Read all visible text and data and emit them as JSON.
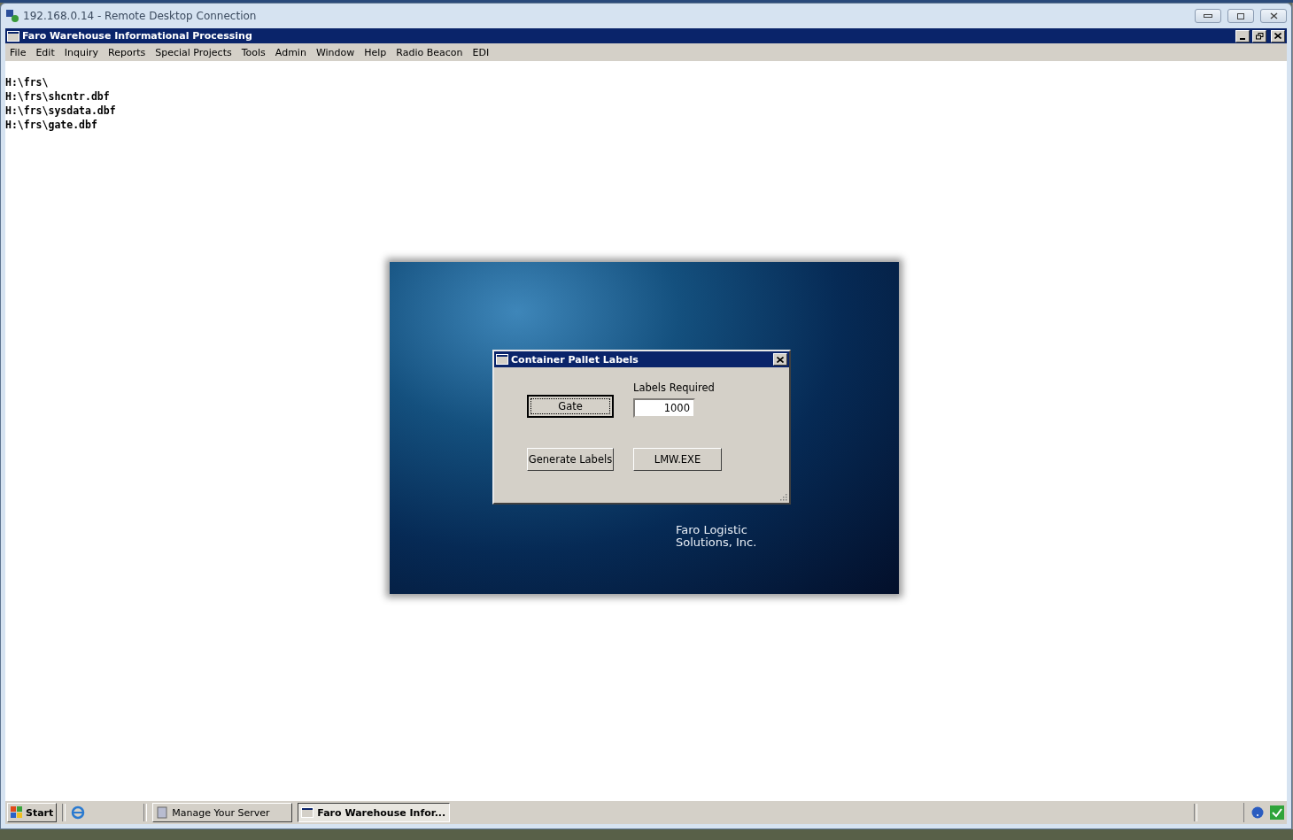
{
  "rdp_window": {
    "title": "192.168.0.14 - Remote Desktop Connection"
  },
  "app_window": {
    "title": "Faro Warehouse Informational Processing"
  },
  "menu": [
    {
      "label": "File"
    },
    {
      "label": "Edit"
    },
    {
      "label": "Inquiry"
    },
    {
      "label": "Reports"
    },
    {
      "label": "Special Projects"
    },
    {
      "label": "Tools"
    },
    {
      "label": "Admin"
    },
    {
      "label": "Window"
    },
    {
      "label": "Help"
    },
    {
      "label": "Radio Beacon"
    },
    {
      "label": "EDI"
    }
  ],
  "output_lines": [
    "H:\\frs\\",
    "H:\\frs\\shcntr.dbf",
    "H:\\frs\\sysdata.dbf",
    "H:\\frs\\gate.dbf"
  ],
  "splash": {
    "caption_lines": [
      "Faro Logistic",
      "Solutions, Inc."
    ]
  },
  "dialog": {
    "title": "Container Pallet Labels",
    "field_label": "Labels Required",
    "field_value": "1000",
    "buttons": [
      {
        "label": "Gate",
        "selected": true
      },
      {
        "label": "Generate Labels",
        "selected": false
      },
      {
        "label": "LMW.EXE",
        "selected": false
      }
    ]
  },
  "taskbar": {
    "start": "Start",
    "tasks": [
      {
        "label": "Manage Your Server",
        "selected": false
      },
      {
        "label": "Faro Warehouse Infor...",
        "selected": true
      }
    ]
  }
}
